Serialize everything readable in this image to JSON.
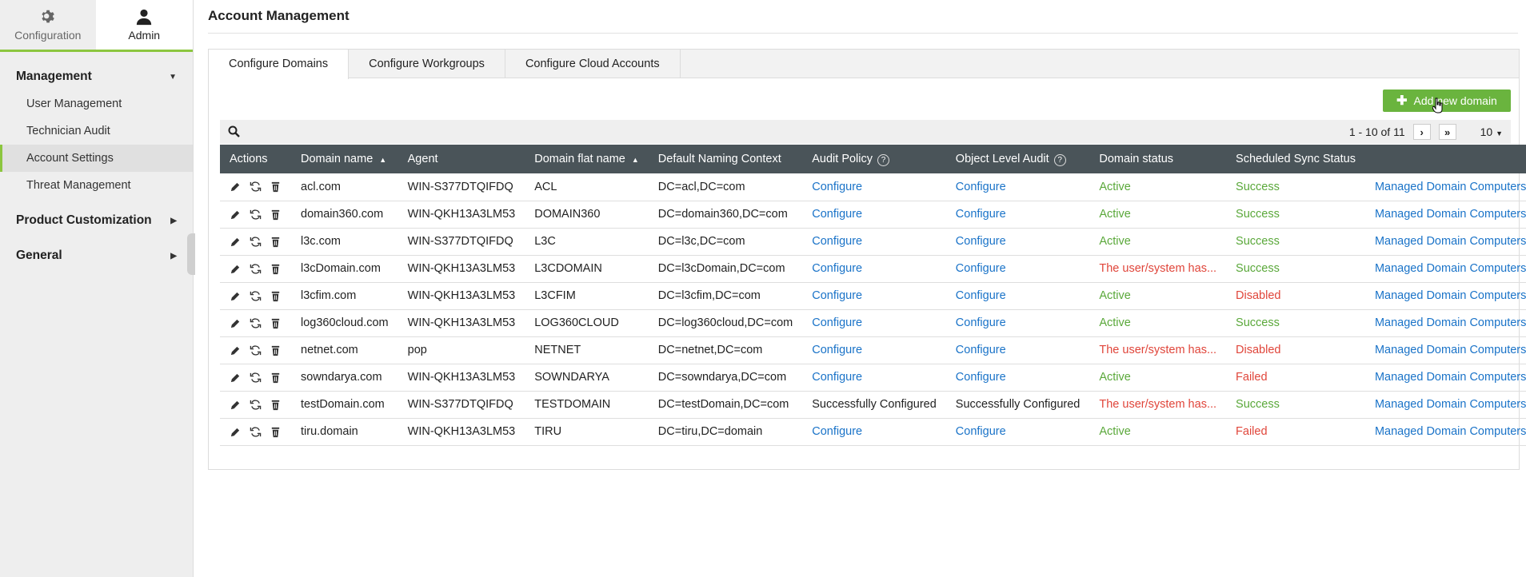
{
  "top_tabs": {
    "configuration": "Configuration",
    "admin": "Admin"
  },
  "sidebar": {
    "management": "Management",
    "items": [
      "User Management",
      "Technician Audit",
      "Account Settings",
      "Threat Management"
    ],
    "product_customization": "Product Customization",
    "general": "General"
  },
  "page_title": "Account Management",
  "tabs": [
    "Configure Domains",
    "Configure Workgroups",
    "Configure Cloud Accounts"
  ],
  "add_button": "Add new domain",
  "pager": {
    "range": "1 - 10 of 11",
    "page_size": "10"
  },
  "columns": [
    "Actions",
    "Domain name",
    "Agent",
    "Domain flat name",
    "Default Naming Context",
    "Audit Policy",
    "Object Level Audit",
    "Domain status",
    "Scheduled Sync Status"
  ],
  "rows": [
    {
      "domain": "acl.com",
      "agent": "WIN-S377DTQIFDQ",
      "flat": "ACL",
      "context": "DC=acl,DC=com",
      "audit": "Configure",
      "object": "Configure",
      "status": "Active",
      "sync": "Success",
      "link": "Managed Domain Computers"
    },
    {
      "domain": "domain360.com",
      "agent": "WIN-QKH13A3LM53",
      "flat": "DOMAIN360",
      "context": "DC=domain360,DC=com",
      "audit": "Configure",
      "object": "Configure",
      "status": "Active",
      "sync": "Success",
      "link": "Managed Domain Computers"
    },
    {
      "domain": "l3c.com",
      "agent": "WIN-S377DTQIFDQ",
      "flat": "L3C",
      "context": "DC=l3c,DC=com",
      "audit": "Configure",
      "object": "Configure",
      "status": "Active",
      "sync": "Success",
      "link": "Managed Domain Computers"
    },
    {
      "domain": "l3cDomain.com",
      "agent": "WIN-QKH13A3LM53",
      "flat": "L3CDOMAIN",
      "context": "DC=l3cDomain,DC=com",
      "audit": "Configure",
      "object": "Configure",
      "status": "The user/system has...",
      "sync": "Success",
      "link": "Managed Domain Computers"
    },
    {
      "domain": "l3cfim.com",
      "agent": "WIN-QKH13A3LM53",
      "flat": "L3CFIM",
      "context": "DC=l3cfim,DC=com",
      "audit": "Configure",
      "object": "Configure",
      "status": "Active",
      "sync": "Disabled",
      "link": "Managed Domain Computers"
    },
    {
      "domain": "log360cloud.com",
      "agent": "WIN-QKH13A3LM53",
      "flat": "LOG360CLOUD",
      "context": "DC=log360cloud,DC=com",
      "audit": "Configure",
      "object": "Configure",
      "status": "Active",
      "sync": "Success",
      "link": "Managed Domain Computers"
    },
    {
      "domain": "netnet.com",
      "agent": "pop",
      "flat": "NETNET",
      "context": "DC=netnet,DC=com",
      "audit": "Configure",
      "object": "Configure",
      "status": "The user/system has...",
      "sync": "Disabled",
      "link": "Managed Domain Computers"
    },
    {
      "domain": "sowndarya.com",
      "agent": "WIN-QKH13A3LM53",
      "flat": "SOWNDARYA",
      "context": "DC=sowndarya,DC=com",
      "audit": "Configure",
      "object": "Configure",
      "status": "Active",
      "sync": "Failed",
      "link": "Managed Domain Computers"
    },
    {
      "domain": "testDomain.com",
      "agent": "WIN-S377DTQIFDQ",
      "flat": "TESTDOMAIN",
      "context": "DC=testDomain,DC=com",
      "audit": "Successfully Configured",
      "object": "Successfully Configured",
      "status": "The user/system has...",
      "sync": "Success",
      "link": "Managed Domain Computers"
    },
    {
      "domain": "tiru.domain",
      "agent": "WIN-QKH13A3LM53",
      "flat": "TIRU",
      "context": "DC=tiru,DC=domain",
      "audit": "Configure",
      "object": "Configure",
      "status": "Active",
      "sync": "Failed",
      "link": "Managed Domain Computers"
    }
  ]
}
